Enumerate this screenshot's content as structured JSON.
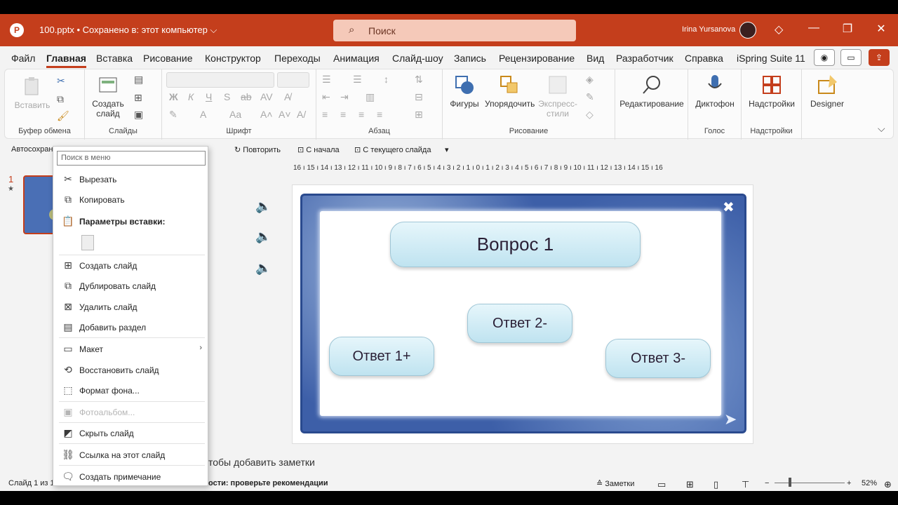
{
  "titlebar": {
    "logo": "P",
    "filename": "100.pptx • Сохранено в: этот компьютер ⌵",
    "search_placeholder": "Поиск",
    "user": "Irina Yursanova"
  },
  "tabs": [
    "Файл",
    "Главная",
    "Вставка",
    "Рисование",
    "Конструктор",
    "Переходы",
    "Анимация",
    "Слайд-шоу",
    "Запись",
    "Рецензирование",
    "Вид",
    "Разработчик",
    "Справка",
    "iSpring Suite 11"
  ],
  "ribbon": {
    "clipboard": {
      "paste": "Вставить",
      "label": "Буфер обмена"
    },
    "slides": {
      "new_slide_line1": "Создать",
      "new_slide_line2": "слайд",
      "label": "Слайды"
    },
    "font": {
      "label": "Шрифт"
    },
    "paragraph": {
      "label": "Абзац"
    },
    "drawing": {
      "shapes": "Фигуры",
      "arrange": "Упорядочить",
      "quick_line1": "Экспресс-",
      "quick_line2": "стили",
      "label": "Рисование"
    },
    "editing": {
      "label": "Редактирование"
    },
    "voice": {
      "dictate": "Диктофон",
      "label": "Голос"
    },
    "addins": {
      "addins": "Надстройки",
      "label": "Надстройки"
    },
    "designer": "Designer"
  },
  "qat": {
    "autosave": "Автосохране",
    "repeat": "Повторить",
    "from_start": "С начала",
    "from_current": "С текущего слайда"
  },
  "slide_pane": {
    "number": "1",
    "star": "★"
  },
  "ruler": "16 ı 15 ı 14 ı 13 ı 12 ı 11 ı 10 ı 9 ı 8 ı 7 ı 6 ı 5 ı 4 ı 3 ı 2 ı 1 ı 0 ı 1 ı 2 ı 3 ı 4 ı 5 ı 6 ı 7 ı 8 ı 9 ı 10 ı 11 ı 12 ı 13 ı 14 ı 15 ı 16",
  "slide": {
    "question": "Вопрос 1",
    "answer1": "Ответ 1+",
    "answer2": "Ответ 2-",
    "answer3": "Ответ 3-"
  },
  "notes": "тобы добавить заметки",
  "status": {
    "slide_of": "Слайд 1 из 1",
    "accessibility": "ости: проверьте рекомендации",
    "notes_btn": "Заметки",
    "zoom": "52%"
  },
  "context_menu": {
    "search_placeholder": "Поиск в меню",
    "items": {
      "cut": "Вырезать",
      "copy": "Копировать",
      "paste_options": "Параметры вставки:",
      "new_slide": "Создать слайд",
      "duplicate": "Дублировать слайд",
      "delete": "Удалить слайд",
      "add_section": "Добавить раздел",
      "layout": "Макет",
      "reset": "Восстановить слайд",
      "format_bg": "Формат фона...",
      "photo_album": "Фотоальбом...",
      "hide": "Скрыть слайд",
      "link": "Ссылка на этот слайд",
      "comment": "Создать примечание"
    }
  },
  "colors": {
    "accent": "#c43e1c",
    "frame": "#3d5fa8",
    "pill": "#bfe3f0"
  }
}
